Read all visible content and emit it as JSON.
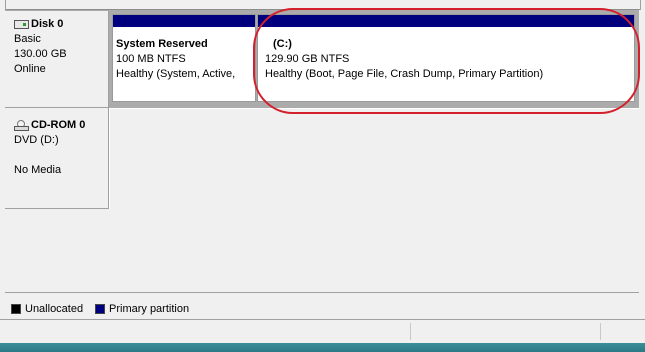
{
  "disks": [
    {
      "name": "Disk 0",
      "type": "Basic",
      "size": "130.00 GB",
      "status": "Online",
      "partitions": [
        {
          "name": "System Reserved",
          "size": "100 MB NTFS",
          "status": "Healthy (System, Active,"
        },
        {
          "name": "(C:)",
          "size": "129.90 GB NTFS",
          "status": "Healthy (Boot, Page File, Crash Dump, Primary Partition)"
        }
      ]
    },
    {
      "name": "CD-ROM 0",
      "type": "DVD (D:)",
      "status": "No Media"
    }
  ],
  "legend": [
    {
      "label": "Unallocated",
      "color": "#000000"
    },
    {
      "label": "Primary partition",
      "color": "#00007f"
    }
  ],
  "colors": {
    "primary_partition_bar": "#00007f",
    "annotation_ellipse": "#d4202c"
  }
}
